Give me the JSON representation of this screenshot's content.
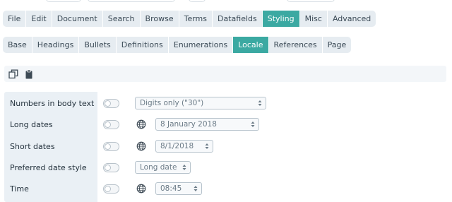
{
  "main_tabs": [
    {
      "label": "File",
      "active": false
    },
    {
      "label": "Edit",
      "active": false
    },
    {
      "label": "Document",
      "active": false
    },
    {
      "label": "Search",
      "active": false
    },
    {
      "label": "Browse",
      "active": false
    },
    {
      "label": "Terms",
      "active": false
    },
    {
      "label": "Datafields",
      "active": false
    },
    {
      "label": "Styling",
      "active": true
    },
    {
      "label": "Misc",
      "active": false
    },
    {
      "label": "Advanced",
      "active": false
    }
  ],
  "sub_tabs": [
    {
      "label": "Base",
      "active": false
    },
    {
      "label": "Headings",
      "active": false
    },
    {
      "label": "Bullets",
      "active": false
    },
    {
      "label": "Definitions",
      "active": false
    },
    {
      "label": "Enumerations",
      "active": false
    },
    {
      "label": "Locale",
      "active": true
    },
    {
      "label": "References",
      "active": false
    },
    {
      "label": "Page",
      "active": false
    }
  ],
  "toolbar": {
    "icons": [
      "copy-icon",
      "clipboard-icon"
    ]
  },
  "settings": [
    {
      "label": "Numbers in body text",
      "enabled": false,
      "locale_icon": false,
      "value": "Digits only (\"30\")"
    },
    {
      "label": "Long dates",
      "enabled": false,
      "locale_icon": true,
      "value": "8 January 2018"
    },
    {
      "label": "Short dates",
      "enabled": false,
      "locale_icon": true,
      "value": "8/1/2018"
    },
    {
      "label": "Preferred date style",
      "enabled": false,
      "locale_icon": false,
      "value": "Long date"
    },
    {
      "label": "Time",
      "enabled": false,
      "locale_icon": true,
      "value": "08:45"
    }
  ],
  "colors": {
    "accent": "#3ba9a2",
    "tab_bg": "#e6ecf1",
    "label_col_bg": "#eaf0f5"
  }
}
